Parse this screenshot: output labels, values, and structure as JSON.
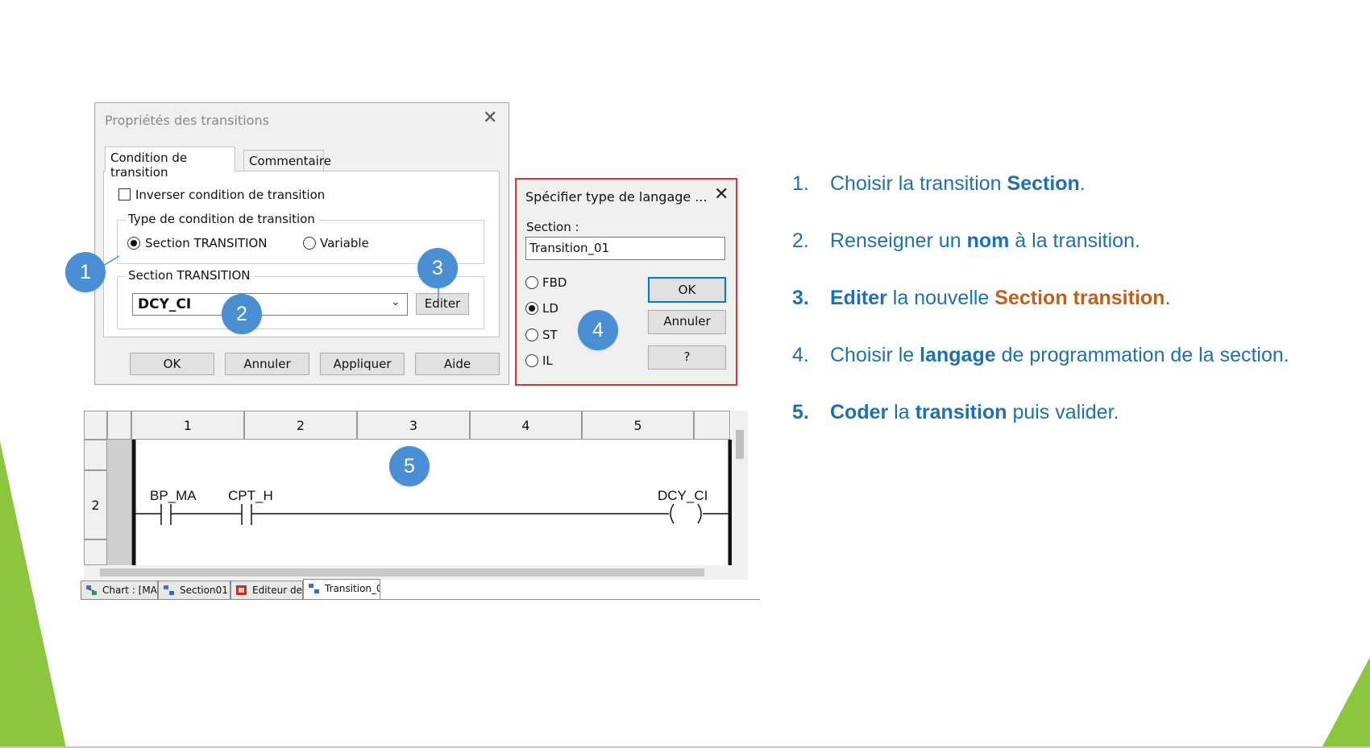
{
  "colors": {
    "accent_blue": "#1f6fb3",
    "bubble_blue": "#4a8fd4",
    "orange": "#c0601a",
    "green": "#8cc63f",
    "red_border": "#e0303a"
  },
  "dialog1": {
    "title": "Propriétés des transitions",
    "tabs": [
      "Condition de transition",
      "Commentaire"
    ],
    "invert_checkbox_label": "Inverser condition de transition",
    "type_group_title": "Type de condition de transition",
    "radio_section_label": "Section TRANSITION",
    "radio_variable_label": "Variable",
    "section_group_title": "Section TRANSITION",
    "section_value": "DCY_CI",
    "edit_button": "Editer",
    "buttons": {
      "ok": "OK",
      "cancel": "Annuler",
      "apply": "Appliquer",
      "help": "Aide"
    }
  },
  "dialog2": {
    "title": "Spécifier type de langage ...",
    "section_label": "Section :",
    "section_value": "Transition_01",
    "languages": [
      "FBD",
      "LD",
      "ST",
      "IL"
    ],
    "selected_language": "LD",
    "buttons": {
      "ok": "OK",
      "cancel": "Annuler",
      "help": "?"
    }
  },
  "ladder": {
    "columns": [
      "1",
      "2",
      "3",
      "4",
      "5"
    ],
    "row_label": "2",
    "contacts": [
      "BP_MA",
      "CPT_H"
    ],
    "coil": "DCY_CI",
    "bottom_tabs": [
      "Chart : [MA...",
      "Section01 <...",
      "Editeur de d...",
      "Transition_0 ..."
    ]
  },
  "bubbles": [
    "1",
    "2",
    "3",
    "4",
    "5"
  ],
  "steps": [
    {
      "num": "1.",
      "pre": "Choisir la transition ",
      "bold": "Section",
      "post": "."
    },
    {
      "num": "2.",
      "pre": "Renseigner un ",
      "bold": "nom",
      "post": " à la transition."
    },
    {
      "num": "3.",
      "bold1": "Editer",
      "mid": " la nouvelle ",
      "orange": "Section transition",
      "post": "."
    },
    {
      "num": "4.",
      "pre": "Choisir le ",
      "bold": "langage",
      "post": " de programmation de la section."
    },
    {
      "num": "5.",
      "bold1": "Coder",
      "mid": " la ",
      "bold2": "transition",
      "post": " puis valider."
    }
  ]
}
